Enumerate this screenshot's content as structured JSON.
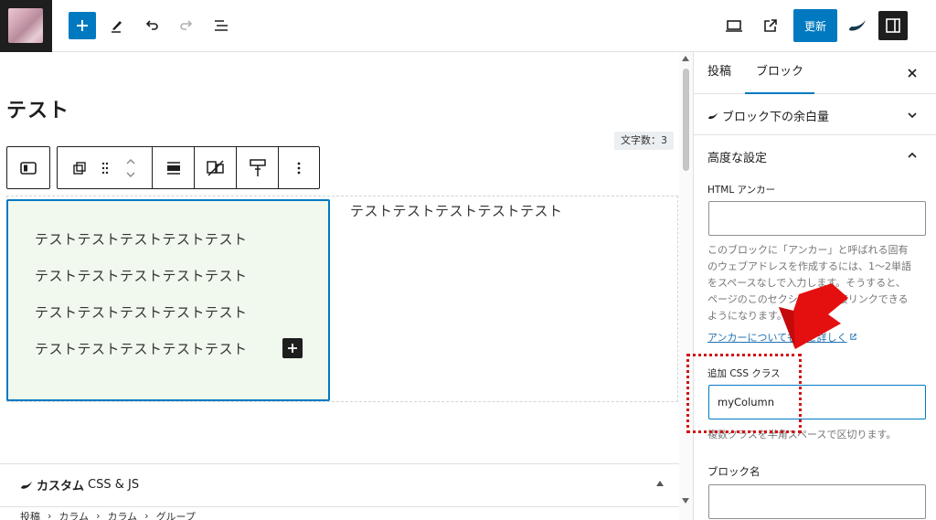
{
  "topbar": {
    "update_label": "更新",
    "icons": [
      "add-block-icon",
      "pencil-icon",
      "undo-icon",
      "redo-icon",
      "list-view-icon",
      "desktop-preview-icon",
      "external-view-icon",
      "plugin-leaf-icon",
      "sidebar-toggle-icon"
    ]
  },
  "editor": {
    "title": "テスト",
    "char_count": "文字数：3",
    "left_column_paragraphs": [
      "テストテストテストテストテスト",
      "テストテストテストテストテスト",
      "テストテストテストテストテスト",
      "テストテストテストテストテスト"
    ],
    "right_column_paragraph": "テストテストテストテストテスト",
    "custom_css_panel": {
      "title_bold": "カスタム",
      "title_rest": "CSS & JS"
    },
    "breadcrumb": [
      "投稿",
      "カラム",
      "カラム",
      "グループ"
    ]
  },
  "sidebar": {
    "tabs": {
      "post": "投稿",
      "block": "ブロック"
    },
    "spacing_panel": "ブロック下の余白量",
    "advanced_panel": "高度な設定",
    "html_anchor": {
      "label": "HTML アンカー",
      "value": "",
      "help_lines": [
        "このブロックに「アンカー」と呼ばれる固有",
        "のウェブアドレスを作成するには、1〜2単語",
        "をスペースなしで入力します。そうすると、",
        "ページのこのセクションに直接リンクできる",
        "ようになります。"
      ],
      "link": "アンカーについてもっと詳しく"
    },
    "css_class": {
      "label": "追加 CSS クラス",
      "value": "myColumn",
      "help": "複数クラスを半角スペースで区切ります。"
    },
    "block_name": {
      "label": "ブロック名",
      "value": ""
    }
  },
  "colors": {
    "accent": "#0079c1",
    "column_bg": "#f1f8ee",
    "annotation": "#d21313"
  }
}
